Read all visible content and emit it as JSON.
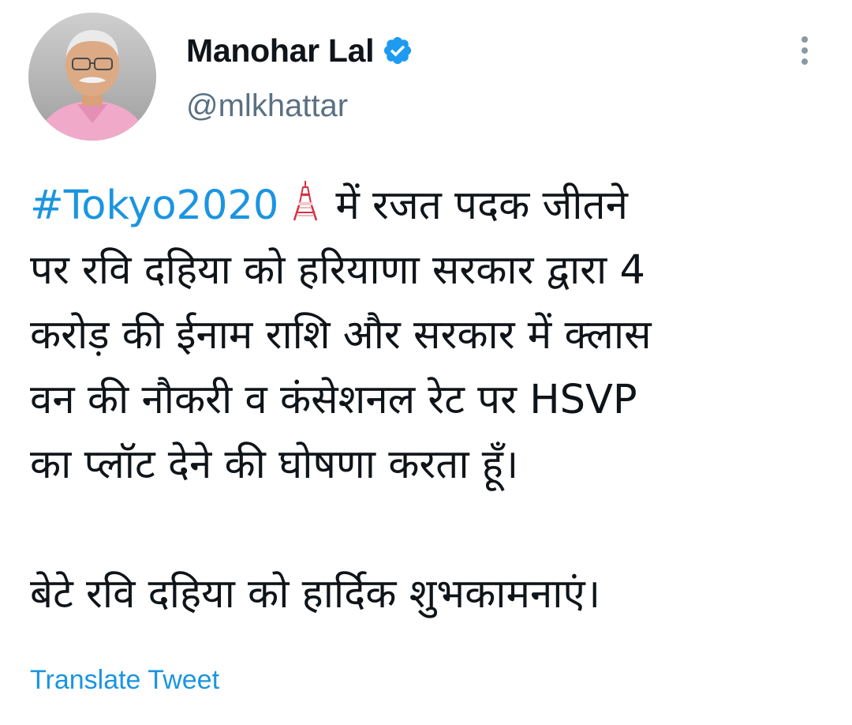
{
  "tweet": {
    "author": {
      "display_name": "Manohar Lal",
      "handle": "@mlkhattar",
      "verified": true,
      "avatar_icon": "profile-photo"
    },
    "more_icon": "more-options-icon",
    "hashtag": "#Tokyo2020",
    "emoji": "tokyo-tower",
    "line1_rest": "में रजत पदक जीतने",
    "line2": "पर रवि दहिया को हरियाणा सरकार द्वारा 4",
    "line3": "करोड़ की ईनाम राशि और सरकार में क्लास",
    "line4": "वन की नौकरी व कंसेशनल रेट पर HSVP",
    "line5": "का प्लॉट देने की घोषणा करता हूँ।",
    "line6": "बेटे रवि दहिया को हार्दिक शुभकामनाएं।",
    "translate_label": "Translate Tweet"
  },
  "colors": {
    "link": "#1b95e0",
    "verified": "#1d9bf0",
    "secondary_text": "#5b7083",
    "primary_text": "#0f1419"
  }
}
